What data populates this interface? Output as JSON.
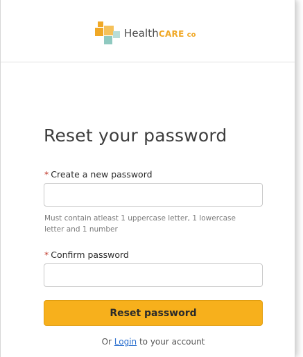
{
  "brand": {
    "name_part1": "Health",
    "name_part2": "CARE",
    "name_part3": "co",
    "accent_color": "#f0a826",
    "secondary_color": "#8fc9c0"
  },
  "page": {
    "title": "Reset your password"
  },
  "form": {
    "new_password": {
      "required_marker": "*",
      "label": "Create a new password",
      "value": "",
      "placeholder": ""
    },
    "hint": "Must contain atleast 1 uppercase letter, 1 lowercase letter and 1 number",
    "confirm_password": {
      "required_marker": "*",
      "label": "Confirm password",
      "value": "",
      "placeholder": ""
    },
    "submit_label": "Reset password",
    "submit_color": "#f7b01c"
  },
  "footer": {
    "prefix": "Or ",
    "link_label": "Login",
    "suffix": " to your account"
  }
}
